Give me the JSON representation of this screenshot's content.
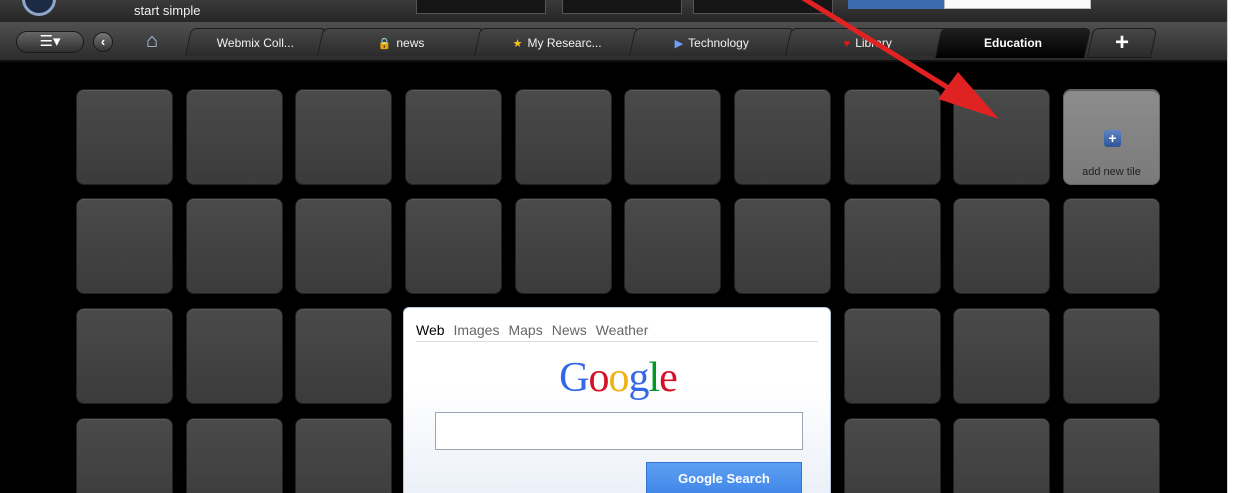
{
  "header": {
    "tagline": "start simple"
  },
  "toolbar": {
    "menu_glyph": "☰▾",
    "back_glyph": "‹",
    "home_glyph": "⌂"
  },
  "tabs": [
    {
      "label": "Webmix Coll...",
      "icon": "",
      "icon_name": ""
    },
    {
      "label": "news",
      "icon": "🔒",
      "icon_name": "lock-icon"
    },
    {
      "label": "My Researc...",
      "icon": "★",
      "icon_name": "star-icon"
    },
    {
      "label": "Technology",
      "icon": "▶",
      "icon_name": "play-icon"
    },
    {
      "label": "Library",
      "icon": "♥",
      "icon_name": "heart-icon"
    },
    {
      "label": "Education",
      "icon": "",
      "icon_name": ""
    }
  ],
  "add_tab_glyph": "+",
  "add_tile": {
    "icon": "+",
    "label": "add new tile"
  },
  "google": {
    "tabs": [
      "Web",
      "Images",
      "Maps",
      "News",
      "Weather"
    ],
    "active_tab": "Web",
    "logo_letters": [
      "G",
      "o",
      "o",
      "g",
      "l",
      "e"
    ],
    "logo_colors": [
      "#3369e8",
      "#d50f25",
      "#eeb211",
      "#3369e8",
      "#009925",
      "#d50f25"
    ],
    "search_value": "",
    "button_label": "Google Search"
  },
  "colors": {
    "background": "#000000",
    "tile": "#444444",
    "add_tile": "#858585",
    "arrow": "#e02222",
    "google_button": "#4a8fee"
  }
}
